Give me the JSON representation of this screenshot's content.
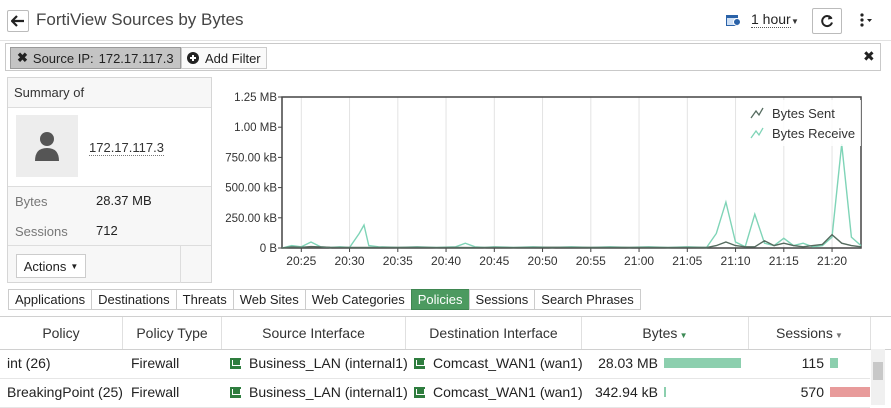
{
  "header": {
    "title": "FortiView Sources by Bytes",
    "time_range": "1 hour"
  },
  "filter_bar": {
    "chip_field": "Source IP:",
    "chip_value": "172.17.117.3",
    "add_filter_label": "Add Filter"
  },
  "summary": {
    "title": "Summary of",
    "ip": "172.17.117.3",
    "bytes_label": "Bytes",
    "bytes_value": "28.37 MB",
    "sessions_label": "Sessions",
    "sessions_value": "712",
    "actions_label": "Actions"
  },
  "chart_data": {
    "type": "line",
    "x_ticks": [
      "20:25",
      "20:30",
      "20:35",
      "20:40",
      "20:45",
      "20:50",
      "20:55",
      "21:00",
      "21:05",
      "21:10",
      "21:15",
      "21:20"
    ],
    "y_ticks": [
      "0 B",
      "250.00 kB",
      "500.00 kB",
      "750.00 kB",
      "1.00 MB",
      "1.25 MB"
    ],
    "ylim": [
      0,
      1.25
    ],
    "y_unit": "MB",
    "xlim_minutes": [
      -2,
      58
    ],
    "legend_position": "top-right",
    "series": [
      {
        "name": "Bytes Sent",
        "color": "#556b5f",
        "x": [
          -2,
          -1,
          0,
          1,
          3,
          6,
          8,
          10,
          12,
          14,
          16,
          18,
          20,
          22,
          24,
          26,
          28,
          30,
          32,
          34,
          36,
          38,
          40,
          42,
          43,
          44,
          45,
          46,
          47,
          48,
          49,
          50,
          51,
          52,
          53,
          54,
          55,
          56,
          57,
          58
        ],
        "values": [
          0,
          0.008,
          0.006,
          0.012,
          0.006,
          0.004,
          0.005,
          0.004,
          0.006,
          0.003,
          0.004,
          0.003,
          0.005,
          0.003,
          0.004,
          0.006,
          0.005,
          0.004,
          0.004,
          0.005,
          0.004,
          0.003,
          0.005,
          0.004,
          0.02,
          0.05,
          0.02,
          0.01,
          0.01,
          0.06,
          0.02,
          0.04,
          0.02,
          0.01,
          0.02,
          0.03,
          0.11,
          0.04,
          0.02,
          0.01
        ]
      },
      {
        "name": "Bytes Receive",
        "color": "#7fd4b7",
        "x": [
          -2,
          -1,
          0,
          1,
          2,
          3,
          4,
          5,
          6,
          6.5,
          7,
          8,
          10,
          12,
          14,
          16,
          17,
          18,
          19,
          20,
          22,
          24,
          26,
          28,
          30,
          32,
          34,
          36,
          38,
          40,
          42,
          43,
          44,
          45,
          46,
          47,
          48,
          49,
          50,
          51,
          52,
          53,
          54,
          55,
          56,
          57,
          58
        ],
        "values": [
          0,
          0.02,
          0.01,
          0.05,
          0.01,
          0.005,
          0.01,
          0.005,
          0.12,
          0.19,
          0.02,
          0.01,
          0.005,
          0.01,
          0.005,
          0.01,
          0.04,
          0.01,
          0.005,
          0.01,
          0.005,
          0.01,
          0.005,
          0.01,
          0.005,
          0.01,
          0.005,
          0.01,
          0.005,
          0.01,
          0.005,
          0.12,
          0.38,
          0.05,
          0.01,
          0.28,
          0.04,
          0.02,
          0.08,
          0.02,
          0.04,
          0.01,
          0.02,
          0.09,
          0.86,
          0.09,
          0.02
        ]
      }
    ]
  },
  "tabs": [
    "Applications",
    "Destinations",
    "Threats",
    "Web Sites",
    "Web Categories",
    "Policies",
    "Sessions",
    "Search Phrases"
  ],
  "active_tab": "Policies",
  "table": {
    "columns": [
      "Policy",
      "Policy Type",
      "Source Interface",
      "Destination Interface",
      "Bytes",
      "Sessions"
    ],
    "rows": [
      {
        "policy": "int (26)",
        "type": "Firewall",
        "src": "Business_LAN (internal1)",
        "dst": "Comcast_WAN1 (wan1)",
        "bytes": "28.03 MB",
        "bytes_fraction": 0.99,
        "sessions": "115",
        "sessions_fraction": 0.2
      },
      {
        "policy": "BreakingPoint (25)",
        "type": "Firewall",
        "src": "Business_LAN (internal1)",
        "dst": "Comcast_WAN1 (wan1)",
        "bytes": "342.94 kB",
        "bytes_fraction": 0.012,
        "sessions": "570",
        "sessions_fraction": 1.0
      }
    ],
    "bytes_bar_color": "#8ccfae",
    "sessions_bar_colors": [
      "#8ccfae",
      "#e89b9b"
    ]
  }
}
